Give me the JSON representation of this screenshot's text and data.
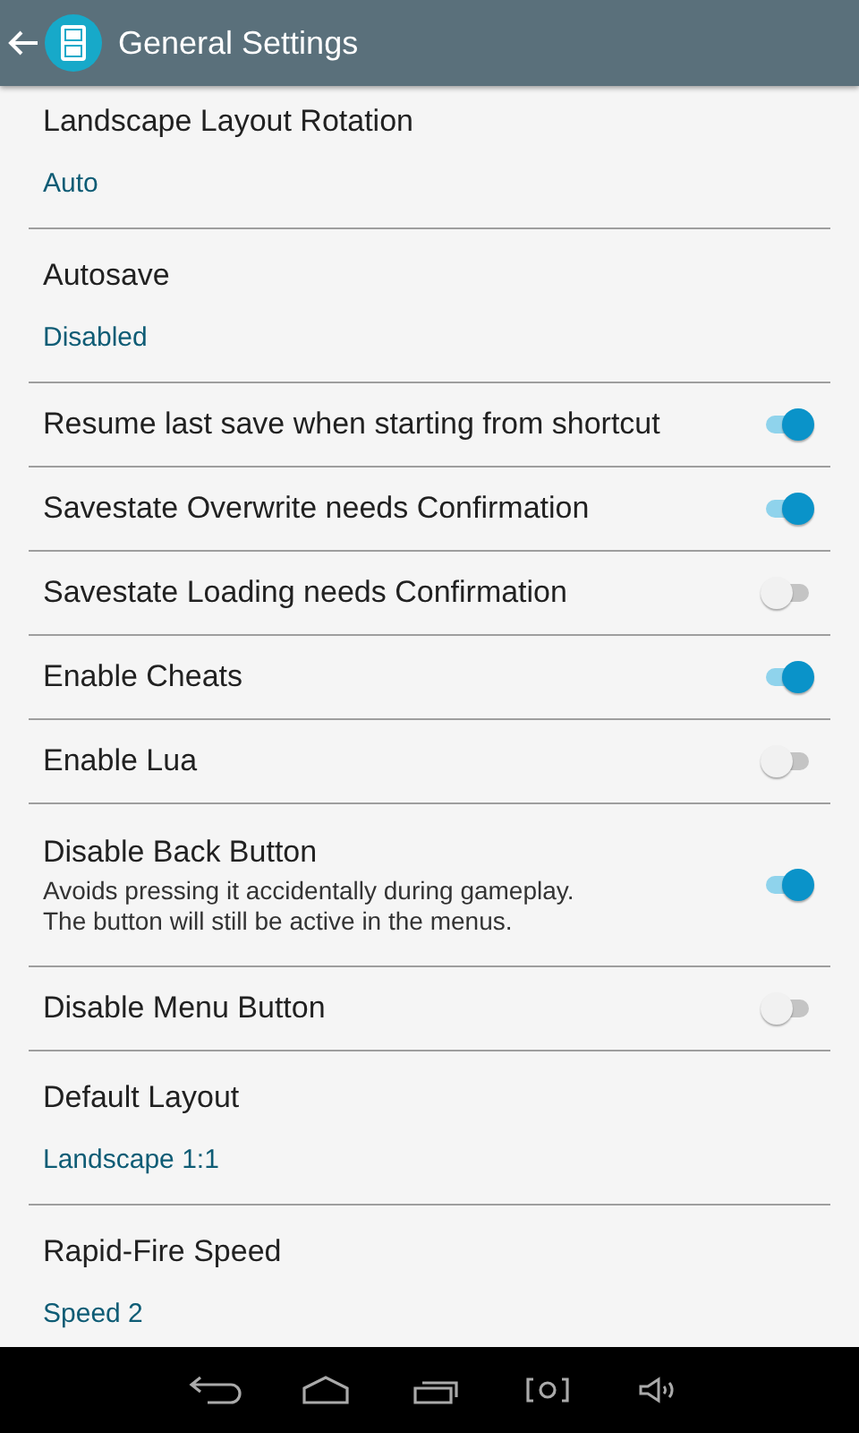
{
  "action_bar": {
    "title": "General Settings"
  },
  "preferences": [
    {
      "kind": "list",
      "title": "Landscape Layout Rotation",
      "summary": "Auto"
    },
    {
      "kind": "list",
      "title": "Autosave",
      "summary": "Disabled"
    },
    {
      "kind": "switch",
      "title": "Resume last save when starting from shortcut",
      "on": true
    },
    {
      "kind": "switch",
      "title": "Savestate Overwrite needs Confirmation",
      "on": true
    },
    {
      "kind": "switch",
      "title": "Savestate Loading needs Confirmation",
      "on": false
    },
    {
      "kind": "switch",
      "title": "Enable Cheats",
      "on": true
    },
    {
      "kind": "switch",
      "title": "Enable Lua",
      "on": false
    },
    {
      "kind": "switch",
      "title": "Disable Back Button",
      "description": "Avoids pressing it accidentally during gameplay.\nThe button will still be active in the menus.",
      "on": true
    },
    {
      "kind": "switch",
      "title": "Disable Menu Button",
      "on": false
    },
    {
      "kind": "list",
      "title": "Default Layout",
      "summary": "Landscape 1:1"
    },
    {
      "kind": "list",
      "title": "Rapid-Fire Speed",
      "summary": "Speed 2"
    }
  ]
}
